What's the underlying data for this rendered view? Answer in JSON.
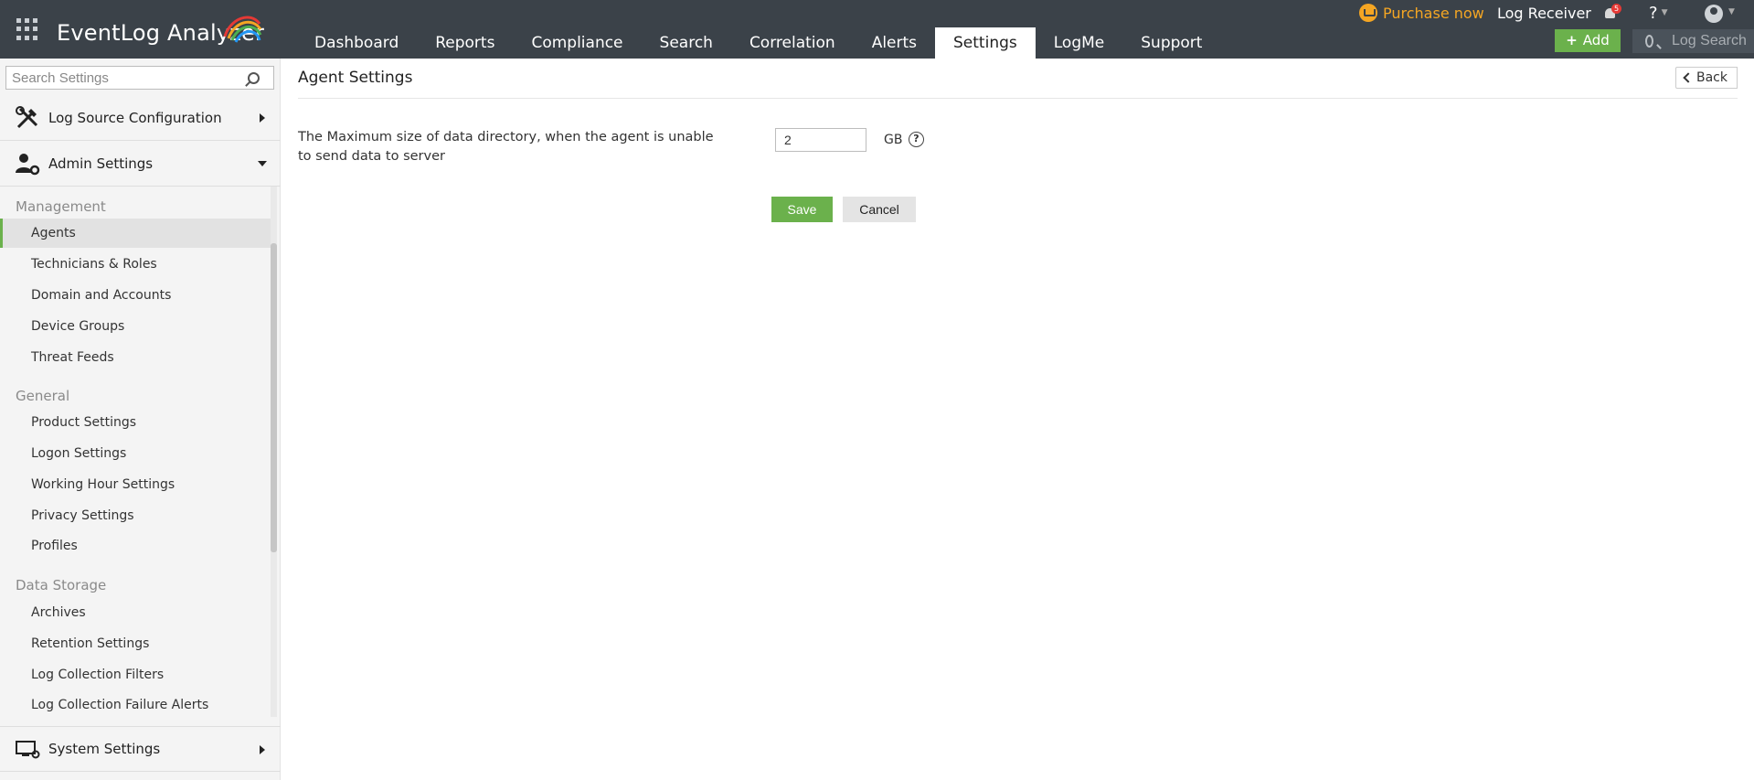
{
  "header": {
    "app_name": "EventLog Analyzer",
    "nav": [
      {
        "label": "Dashboard"
      },
      {
        "label": "Reports"
      },
      {
        "label": "Compliance"
      },
      {
        "label": "Search"
      },
      {
        "label": "Correlation"
      },
      {
        "label": "Alerts"
      },
      {
        "label": "Settings",
        "active": true
      },
      {
        "label": "LogMe"
      },
      {
        "label": "Support"
      }
    ],
    "purchase_label": "Purchase now",
    "log_receiver_label": "Log Receiver",
    "notification_count": "5",
    "help_label": "?",
    "add_label": "Add",
    "log_search_placeholder": "Log Search",
    "colors": {
      "bar": "#3b4249",
      "accent": "#6bb14c",
      "purchase": "#f5a623"
    }
  },
  "sidebar": {
    "search_placeholder": "Search Settings",
    "sections": {
      "log_source": "Log Source Configuration",
      "admin": "Admin Settings",
      "system": "System Settings"
    },
    "groups": {
      "management": "Management",
      "general": "General",
      "data_storage": "Data Storage"
    },
    "management_items": [
      "Agents",
      "Technicians & Roles",
      "Domain and Accounts",
      "Device Groups",
      "Threat Feeds"
    ],
    "general_items": [
      "Product Settings",
      "Logon Settings",
      "Working Hour Settings",
      "Privacy Settings",
      "Profiles"
    ],
    "data_storage_items": [
      "Archives",
      "Retention Settings",
      "Log Collection Filters",
      "Log Collection Failure Alerts"
    ],
    "active_item": "Agents"
  },
  "main": {
    "title": "Agent Settings",
    "back_label": "Back",
    "field_label": "The Maximum size of data directory, when the agent is unable to send data to server",
    "field_value": "2",
    "unit": "GB",
    "help_glyph": "?",
    "save_label": "Save",
    "cancel_label": "Cancel"
  }
}
